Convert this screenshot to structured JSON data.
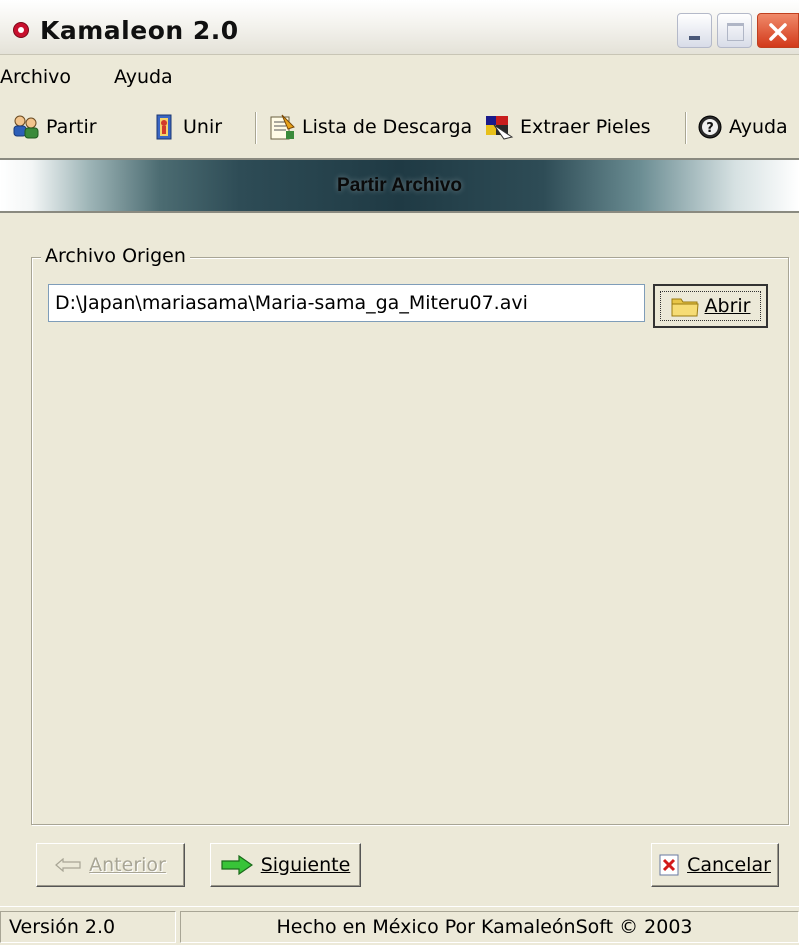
{
  "window": {
    "title": "Kamaleon 2.0"
  },
  "menu": {
    "items": [
      "Archivo",
      "Ayuda"
    ]
  },
  "toolbar": {
    "items": [
      {
        "label": "Partir",
        "icon": "split-people-icon"
      },
      {
        "label": "Unir",
        "icon": "join-book-icon"
      },
      {
        "label": "Lista de Descarga",
        "icon": "download-list-icon"
      },
      {
        "label": "Extraer Pieles",
        "icon": "extract-skins-icon"
      },
      {
        "label": "Ayuda",
        "icon": "help-icon"
      }
    ]
  },
  "banner": {
    "title": "Partir Archivo"
  },
  "source": {
    "legend": "Archivo Origen",
    "path": "D:\\Japan\\mariasama\\Maria-sama_ga_Miteru07.avi",
    "browse_label": "Abrir"
  },
  "buttons": {
    "prev_label": "Anterior",
    "next_label": "Siguiente",
    "cancel_label": "Cancelar"
  },
  "status": {
    "version": "Versión 2.0",
    "credits": "Hecho en México Por KamaleónSoft © 2003"
  },
  "colors": {
    "window_bg": "#ECE9D8",
    "banner_dark": "#1f3a44",
    "next_arrow": "#2eb82e",
    "cancel_x": "#d21a1a"
  }
}
